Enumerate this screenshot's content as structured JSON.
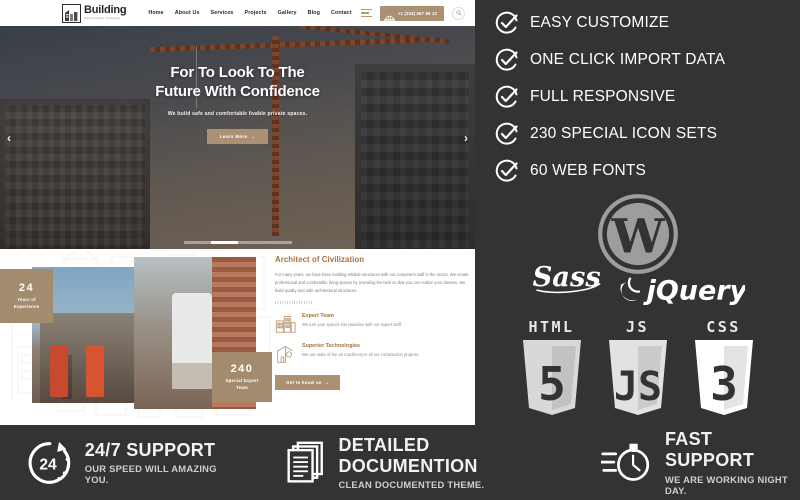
{
  "preview": {
    "header": {
      "logo_name": "Building",
      "logo_sub": "Construction Company",
      "nav": [
        {
          "label": "Home"
        },
        {
          "label": "About Us"
        },
        {
          "label": "Services"
        },
        {
          "label": "Projects"
        },
        {
          "label": "Gallery"
        },
        {
          "label": "Blog"
        },
        {
          "label": "Contact"
        }
      ],
      "phone": "+1 (234) 567 89 10",
      "menu_icon": "hamburger-icon",
      "search_icon": "search-icon",
      "helmet_icon": "helmet-icon"
    },
    "hero": {
      "title_line1": "For To Look To The",
      "title_line2": "Future With Confidence",
      "subtitle": "We build safe and comfortable livable private spaces.",
      "button": "Learn More",
      "button_arrow": "→",
      "prev_arrow": "‹",
      "next_arrow": "›",
      "slides": 4,
      "active_slide": 2
    },
    "about": {
      "stat1_number": "24",
      "stat1_label_l1": "Years of",
      "stat1_label_l2": "Experience",
      "stat2_number": "240",
      "stat2_label_l1": "Special Expert",
      "stat2_label_l2": "Team",
      "title": "Architect of Civilization",
      "paragraph": "For many years, we have been building reliable structures with our competent staff in the sector. We create professional and comfortable living spaces by revealing the best so that you can realize your dreams. We build quality and safe architectural structures.",
      "features": [
        {
          "heading": "Expert Team",
          "text": "We turn your spaces into paradise with our expert staff.",
          "icon": "building-icon"
        },
        {
          "heading": "Superior Technologies",
          "text": "We use state of the art machinery in all our construction projects.",
          "icon": "crane-icon"
        }
      ],
      "button": "Get to know us",
      "button_arrow": "→"
    }
  },
  "right_panel": {
    "features": [
      {
        "label": "EASY CUSTOMIZE",
        "icon": "check-circle-icon"
      },
      {
        "label": "ONE CLICK IMPORT DATA",
        "icon": "check-circle-icon"
      },
      {
        "label": "FULL RESPONSIVE",
        "icon": "check-circle-icon"
      },
      {
        "label": "230 SPECIAL ICON SETS",
        "icon": "check-circle-icon"
      },
      {
        "label": "60 WEB FONTS",
        "icon": "check-circle-icon"
      }
    ],
    "tech": {
      "wordpress": "wordpress-logo",
      "sass": "Sass",
      "jquery": "jQuery",
      "shields": [
        {
          "name": "HTML",
          "digit": "5"
        },
        {
          "name": "JS",
          "digit": "JS"
        },
        {
          "name": "CSS",
          "digit": "3"
        }
      ]
    }
  },
  "footer": {
    "items": [
      {
        "icon": "24-clock-icon",
        "heading": "24/7 SUPPORT",
        "sub": "OUR SPEED WILL AMAZING YOU.",
        "badge": "24"
      },
      {
        "icon": "documents-icon",
        "heading": "DETAILED DOCUMENTION",
        "sub": "CLEAN DOCUMENTED THEME."
      },
      {
        "icon": "stopwatch-icon",
        "heading": "FAST SUPPORT",
        "sub": "WE ARE WORKING NIGHT DAY."
      }
    ]
  },
  "colors": {
    "panel_bg": "#333333",
    "accent_gold": "#ab9173",
    "accent_brown": "#a5713f",
    "stat_box": "#a38b6e",
    "white": "#ffffff"
  }
}
